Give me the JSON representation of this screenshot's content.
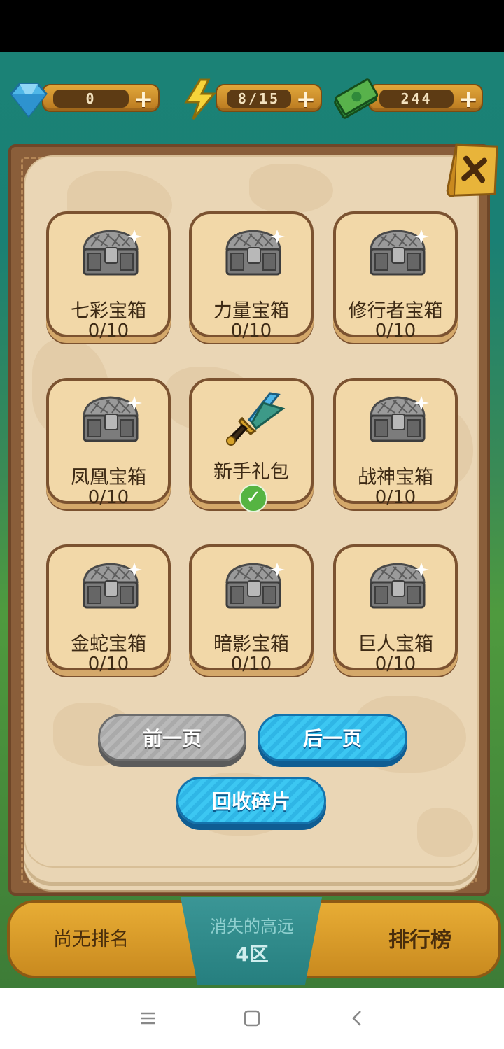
{
  "resources": {
    "gems": "0",
    "energy": "8/15",
    "cash": "244"
  },
  "chests": [
    {
      "name": "七彩宝箱",
      "count": "0/10",
      "icon": "chest-icon"
    },
    {
      "name": "力量宝箱",
      "count": "0/10",
      "icon": "chest-icon"
    },
    {
      "name": "修行者宝箱",
      "count": "0/10",
      "icon": "chest-icon"
    },
    {
      "name": "凤凰宝箱",
      "count": "0/10",
      "icon": "chest-icon"
    },
    {
      "name": "新手礼包",
      "count": "",
      "icon": "sword-icon",
      "claimed": true
    },
    {
      "name": "战神宝箱",
      "count": "0/10",
      "icon": "chest-icon"
    },
    {
      "name": "金蛇宝箱",
      "count": "0/10",
      "icon": "chest-icon"
    },
    {
      "name": "暗影宝箱",
      "count": "0/10",
      "icon": "chest-icon"
    },
    {
      "name": "巨人宝箱",
      "count": "0/10",
      "icon": "chest-icon"
    }
  ],
  "buttons": {
    "prev": "前一页",
    "next": "后一页",
    "recycle": "回收碎片"
  },
  "bottom": {
    "rank_status": "尚无排名",
    "zone_title": "消失的高远",
    "zone_number": "4区",
    "leaderboard": "排行榜"
  },
  "colors": {
    "accent_blue": "#2fb6e6",
    "panel_paper": "#ead6b5",
    "card_bg": "#f2d8a8",
    "claimed_green": "#55b442"
  }
}
